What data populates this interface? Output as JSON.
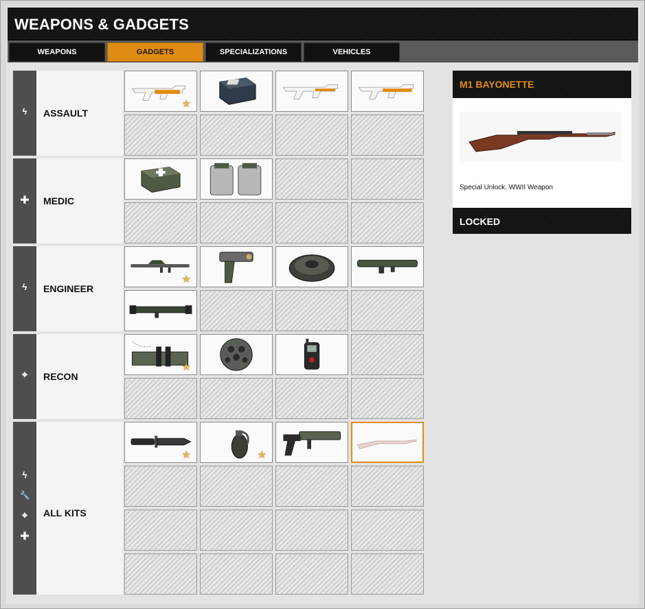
{
  "header": {
    "title": "WEAPONS & GADGETS"
  },
  "tabs": [
    {
      "label": "WEAPONS",
      "active": false
    },
    {
      "label": "GADGETS",
      "active": true
    },
    {
      "label": "SPECIALIZATIONS",
      "active": false
    },
    {
      "label": "VEHICLES",
      "active": false
    }
  ],
  "kits": [
    {
      "label": "ASSAULT",
      "icons": [
        "lightning-icon"
      ]
    },
    {
      "label": "MEDIC",
      "icons": [
        "plus-icon"
      ]
    },
    {
      "label": "ENGINEER",
      "icons": [
        "lightning-icon"
      ]
    },
    {
      "label": "RECON",
      "icons": [
        "crosshair-icon"
      ]
    },
    {
      "label": "ALL KITS",
      "icons": [
        "lightning-icon",
        "wrench-icon",
        "crosshair-icon",
        "plus-icon"
      ]
    }
  ],
  "items": {
    "assault": [
      {
        "icon": "assault-rifle-launcher-icon",
        "star": true
      },
      {
        "icon": "ammo-box-icon",
        "star": false
      },
      {
        "icon": "assault-rifle-grenade-icon",
        "star": false
      },
      {
        "icon": "assault-rifle-shotgun-icon",
        "star": false
      }
    ],
    "medic": [
      {
        "icon": "medkit-icon",
        "star": false
      },
      {
        "icon": "defibrillator-icon",
        "star": false
      }
    ],
    "engineer": [
      {
        "icon": "rpg-launcher-icon",
        "star": true
      },
      {
        "icon": "repair-tool-icon",
        "star": false
      },
      {
        "icon": "anti-tank-mine-icon",
        "star": false
      },
      {
        "icon": "rocket-launcher-icon",
        "star": false
      },
      {
        "icon": "anti-tank-rocket-icon",
        "star": false
      }
    ],
    "recon": [
      {
        "icon": "c4-explosive-icon",
        "star": true
      },
      {
        "icon": "motion-sensor-ball-icon",
        "star": false
      },
      {
        "icon": "radio-beacon-icon",
        "star": false
      }
    ],
    "all_kits": [
      {
        "icon": "combat-knife-icon",
        "star": true
      },
      {
        "icon": "hand-grenade-icon",
        "star": true
      },
      {
        "icon": "mortar-strike-icon",
        "star": false
      },
      {
        "icon": "bayonet-rifle-icon",
        "star": false,
        "selected": true
      }
    ]
  },
  "detail": {
    "title": "M1 BAYONETTE",
    "image_icon": "m1-rifle-bayonet-icon",
    "description": "Special Unlock. WWII Weapon",
    "status": "LOCKED"
  },
  "colors": {
    "accent": "#e08b14",
    "dark": "#111111",
    "kit_bar": "#4e4e4e"
  }
}
